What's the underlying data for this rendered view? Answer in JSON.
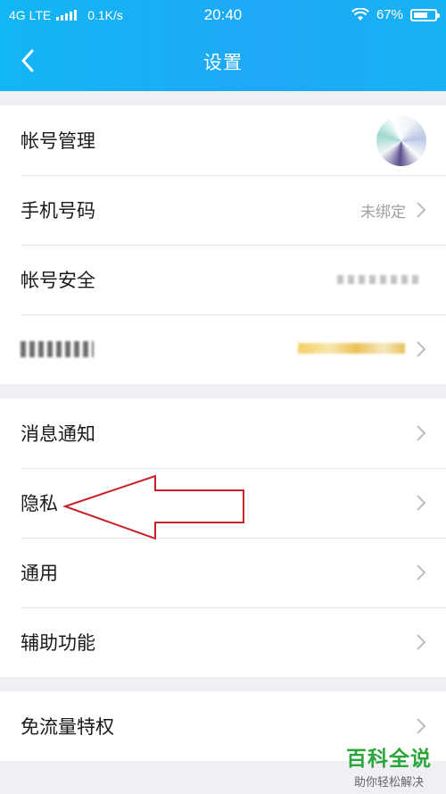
{
  "status_bar": {
    "network": "4G LTE",
    "speed": "0.1K/s",
    "time": "20:40",
    "battery": "67%",
    "battery_level": 0.67
  },
  "nav": {
    "title": "设置",
    "back_icon": "chevron-left-icon"
  },
  "group1": {
    "account_manage": {
      "label": "帐号管理"
    },
    "phone": {
      "label": "手机号码",
      "value": "未绑定"
    },
    "account_security": {
      "label": "帐号安全"
    }
  },
  "group2": {
    "notifications": {
      "label": "消息通知"
    },
    "privacy": {
      "label": "隐私"
    },
    "general": {
      "label": "通用"
    },
    "accessibility": {
      "label": "辅助功能"
    }
  },
  "group3": {
    "free_data": {
      "label": "免流量特权"
    }
  },
  "annotation": {
    "arrow_color": "#c8232c"
  },
  "watermark": {
    "title": "百科全说",
    "subtitle": "助你轻松解决"
  },
  "colors": {
    "header": "#1ea8f6",
    "background": "#efeff4"
  }
}
